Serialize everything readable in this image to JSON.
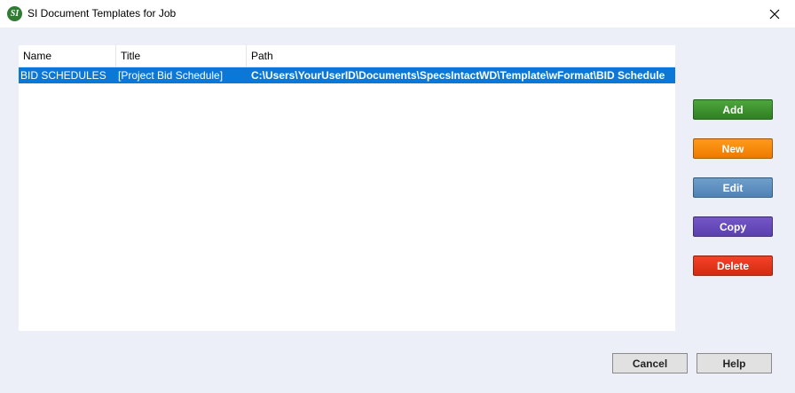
{
  "window": {
    "title": "SI Document Templates for Job",
    "icon_text": "SI",
    "icon": "specsintact-app-icon",
    "close_icon": "close-icon"
  },
  "table": {
    "columns": [
      "Name",
      "Title",
      "Path"
    ],
    "rows": [
      {
        "name": "BID SCHEDULES",
        "title": "[Project Bid Schedule]",
        "path": "C:\\Users\\YourUserID\\Documents\\SpecsIntactWD\\Template\\wFormat\\BID Schedule",
        "selected": true
      }
    ]
  },
  "actions": {
    "add": "Add",
    "new": "New",
    "edit": "Edit",
    "copy": "Copy",
    "delete": "Delete"
  },
  "footer": {
    "cancel": "Cancel",
    "help": "Help"
  },
  "colors": {
    "selection": "#0b78d7",
    "add": "#3a922d",
    "new": "#f58a0c",
    "edit": "#5e90c0",
    "copy": "#664bba",
    "delete": "#e3371c"
  }
}
